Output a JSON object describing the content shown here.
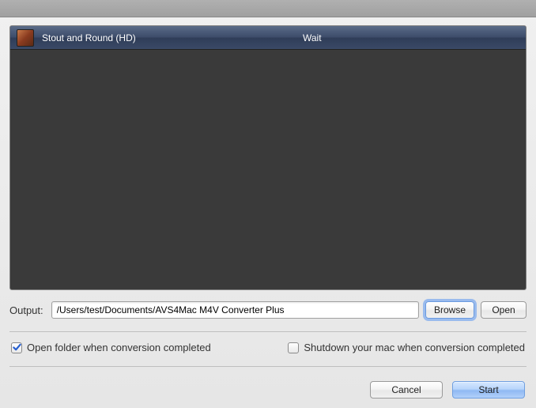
{
  "list": {
    "items": [
      {
        "title": "Stout and Round (HD)",
        "status": "Wait"
      }
    ]
  },
  "output": {
    "label": "Output:",
    "path": "/Users/test/Documents/AVS4Mac M4V Converter Plus",
    "browse_label": "Browse",
    "open_label": "Open"
  },
  "options": {
    "open_folder_label": "Open folder when conversion completed",
    "open_folder_checked": true,
    "shutdown_label": "Shutdown your mac when conversion completed",
    "shutdown_checked": false
  },
  "buttons": {
    "cancel": "Cancel",
    "start": "Start"
  }
}
